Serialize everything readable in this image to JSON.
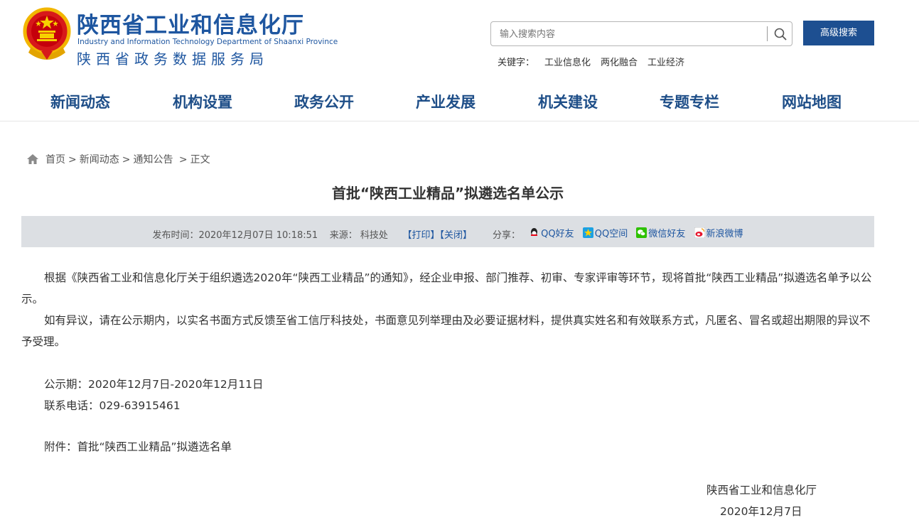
{
  "header": {
    "logo_cn": "陕西省工业和信息化厅",
    "logo_en": "Industry and Information Technology Department of Shaanxi Province",
    "logo_sub": "陕西省政务数据服务局",
    "search": {
      "placeholder": "输入搜索内容"
    },
    "advanced_search_label": "高级搜索",
    "keywords_label": "关键字：",
    "keywords": [
      "工业信息化",
      "两化融合",
      "工业经济"
    ]
  },
  "nav": [
    "新闻动态",
    "机构设置",
    "政务公开",
    "产业发展",
    "机关建设",
    "专题专栏",
    "网站地图"
  ],
  "breadcrumb": [
    "首页",
    "新闻动态",
    "通知公告",
    "正文"
  ],
  "article": {
    "title": "首批“陕西工业精品”拟遴选名单公示",
    "publish_label": "发布时间：",
    "publish_time": "2020年12月07日 10:18:51",
    "source_label": "来源：",
    "source": "科技处",
    "print_label": "【打印】",
    "close_label": "【关闭】",
    "share_label": "分享：",
    "share_items": [
      "QQ好友",
      "QQ空间",
      "微信好友",
      "新浪微博"
    ],
    "paragraphs": [
      "根据《陕西省工业和信息化厅关于组织遴选2020年“陕西工业精品”的通知》，经企业申报、部门推荐、初审、专家评审等环节，现将首批“陕西工业精品”拟遴选名单予以公示。",
      "如有异议，请在公示期内，以实名书面方式反馈至省工信厅科技处，书面意见列举理由及必要证据材料，提供真实姓名和有效联系方式，凡匿名、冒名或超出期限的异议不予受理。"
    ],
    "period": "公示期：2020年12月7日-2020年12月11日",
    "phone": "联系电话：029-63915461",
    "attachment": "附件：首批“陕西工业精品”拟遴选名单",
    "signer": "陕西省工业和信息化厅",
    "sign_date": "2020年12月7日"
  },
  "colors": {
    "brand_blue": "#1e56a0",
    "button_blue": "#1d4f91",
    "meta_bg": "#dcdfe3"
  }
}
